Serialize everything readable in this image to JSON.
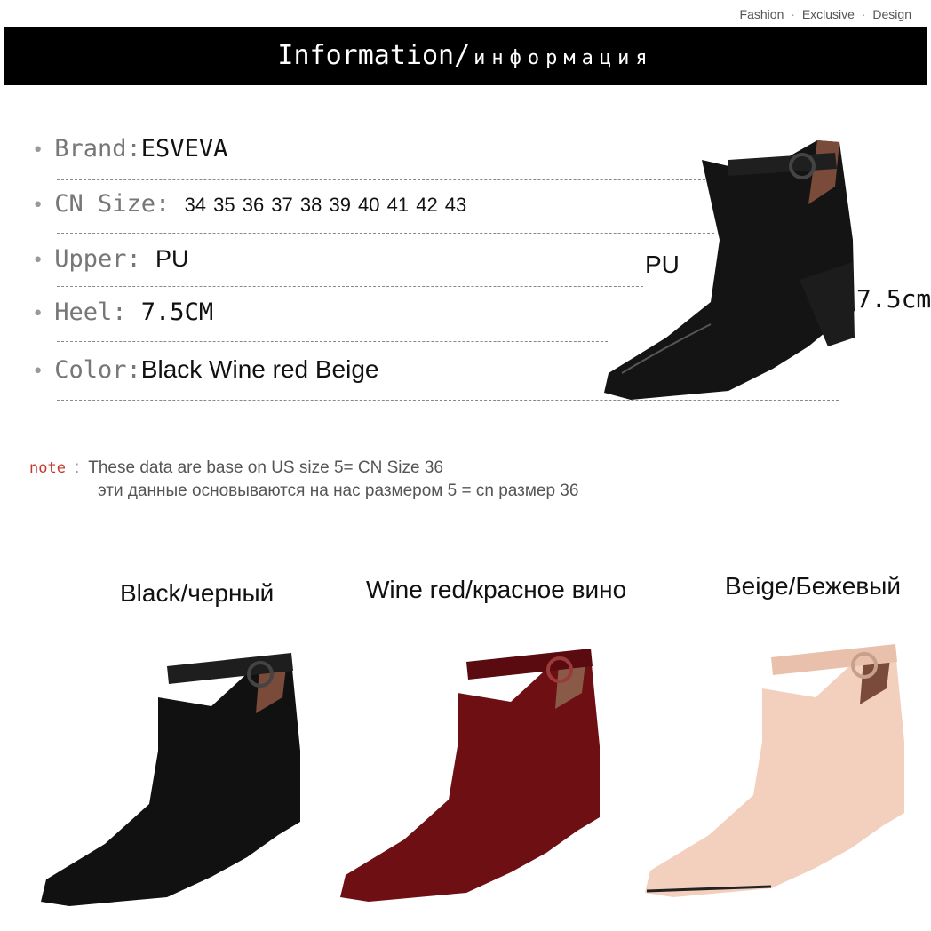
{
  "tagline": {
    "fashion": "Fashion",
    "exclusive": "Exclusive",
    "design": "Design",
    "sep": "·"
  },
  "banner": {
    "title_en": "Information",
    "slash": "/",
    "title_ru": "информация"
  },
  "specs": {
    "brand_label": "Brand:",
    "brand_value": "ESVEVA",
    "size_label": "CN Size:",
    "size_value": "34 35 36 37 38 39 40 41 42 43",
    "upper_label": "Upper: ",
    "upper_value": "PU",
    "heel_label": "Heel: ",
    "heel_value": "7.5CM",
    "color_label": "Color:",
    "color_value": "Black Wine red  Beige"
  },
  "diagram": {
    "material_label": "PU",
    "heel_label": "7.5cm"
  },
  "note": {
    "label": "note",
    "colon": ":",
    "line1": "These data are base on US size 5= CN Size 36",
    "line2": "эти данные основываются на нас размером 5 = cn размер 36"
  },
  "variants": [
    {
      "caption": "Black/черный",
      "color": "#111111"
    },
    {
      "caption": "Wine red/красное вино",
      "color": "#6e0f14"
    },
    {
      "caption": "Beige/Бежевый",
      "color": "#f3cfbd"
    }
  ]
}
